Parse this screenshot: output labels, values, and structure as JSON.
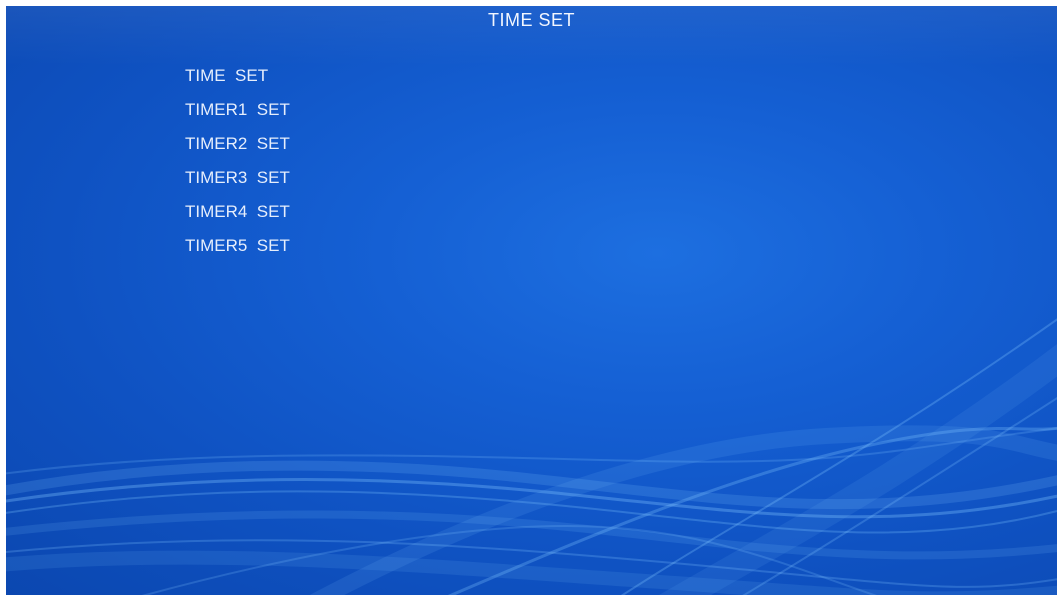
{
  "screen": {
    "title": "TIME SET"
  },
  "menu": {
    "items": [
      {
        "label": "TIME  SET"
      },
      {
        "label": "TIMER1  SET"
      },
      {
        "label": "TIMER2  SET"
      },
      {
        "label": "TIMER3  SET"
      },
      {
        "label": "TIMER4  SET"
      },
      {
        "label": "TIMER5  SET"
      }
    ]
  },
  "colors": {
    "background": "#1560d4",
    "text": "#e6eefc",
    "wave": "#7fc4ff"
  }
}
